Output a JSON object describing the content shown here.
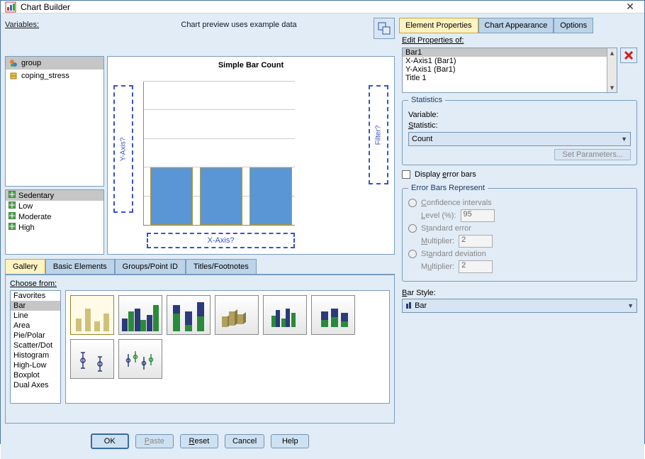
{
  "window": {
    "title": "Chart Builder",
    "close": "✕"
  },
  "left": {
    "vars_label": "Variables:",
    "preview_label": "Chart preview uses example data",
    "vars": [
      "group",
      "coping_stress"
    ],
    "cats": [
      "Sedentary",
      "Low",
      "Moderate",
      "High"
    ],
    "chart_title": "Simple Bar Count",
    "y_drop": "Y-Axis?",
    "x_drop": "X-Axis?",
    "filter_drop": "Filter?"
  },
  "tabs": {
    "gallery": "Gallery",
    "basic": "Basic Elements",
    "groups": "Groups/Point ID",
    "titles": "Titles/Footnotes"
  },
  "gallery": {
    "choose": "Choose from:",
    "types": [
      "Favorites",
      "Bar",
      "Line",
      "Area",
      "Pie/Polar",
      "Scatter/Dot",
      "Histogram",
      "High-Low",
      "Boxplot",
      "Dual Axes"
    ]
  },
  "buttons": {
    "ok": "OK",
    "paste": "Paste",
    "reset": "Reset",
    "cancel": "Cancel",
    "help": "Help"
  },
  "right": {
    "tabs": {
      "ep": "Element Properties",
      "ca": "Chart Appearance",
      "opt": "Options"
    },
    "edit_label": "Edit Properties of:",
    "items": [
      "Bar1",
      "X-Axis1 (Bar1)",
      "Y-Axis1 (Bar1)",
      "Title 1"
    ],
    "stats": {
      "legend": "Statistics",
      "var_label": "Variable:",
      "stat_label": "Statistic:",
      "stat_value": "Count",
      "params": "Set Parameters..."
    },
    "err": {
      "chk_label": "Display error bars",
      "legend": "Error Bars Represent",
      "ci": "Confidence intervals",
      "level_label": "Level (%):",
      "level_val": "95",
      "se": "Standard error",
      "mult_label": "Multiplier:",
      "mult_val": "2",
      "sd": "Standard deviation",
      "sd_mult_val": "2"
    },
    "barstyle": {
      "label": "Bar Style:",
      "value": "Bar"
    }
  },
  "chart_data": {
    "type": "bar",
    "title": "Simple Bar Count",
    "categories": [
      "",
      "",
      ""
    ],
    "values": [
      40,
      40,
      40
    ],
    "xlabel": "X-Axis?",
    "ylabel": "Y-Axis?",
    "ylim": [
      0,
      100
    ]
  }
}
